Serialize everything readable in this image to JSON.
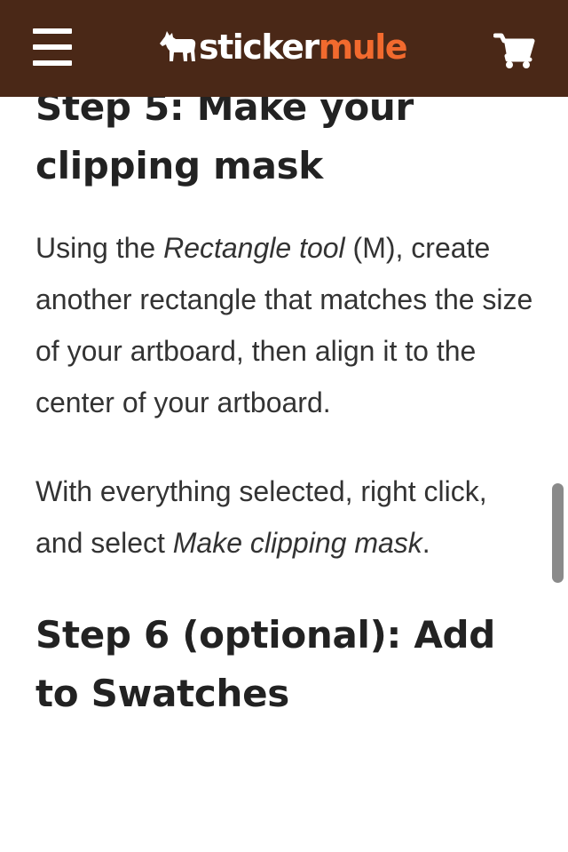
{
  "header": {
    "logo": {
      "part1": "sticker",
      "part2": "mule",
      "brand_color": "#f26a2e"
    },
    "background_color": "#4a2817",
    "menu_icon": "hamburger-menu-icon",
    "cart_icon": "shopping-cart-icon"
  },
  "article": {
    "step5_heading": "Step 5: Make your clipping mask",
    "step5_para1": {
      "text1": "Using the ",
      "em1": "Rectangle tool",
      "text2": " (M), create another rectangle that matches the size of your artboard, then align it to the center of your artboard."
    },
    "step5_para2": {
      "text1": "With everything selected, right click, and select ",
      "em1": "Make clipping mask",
      "text2": "."
    },
    "step6_heading": "Step 6 (optional): Add to Swatches"
  }
}
